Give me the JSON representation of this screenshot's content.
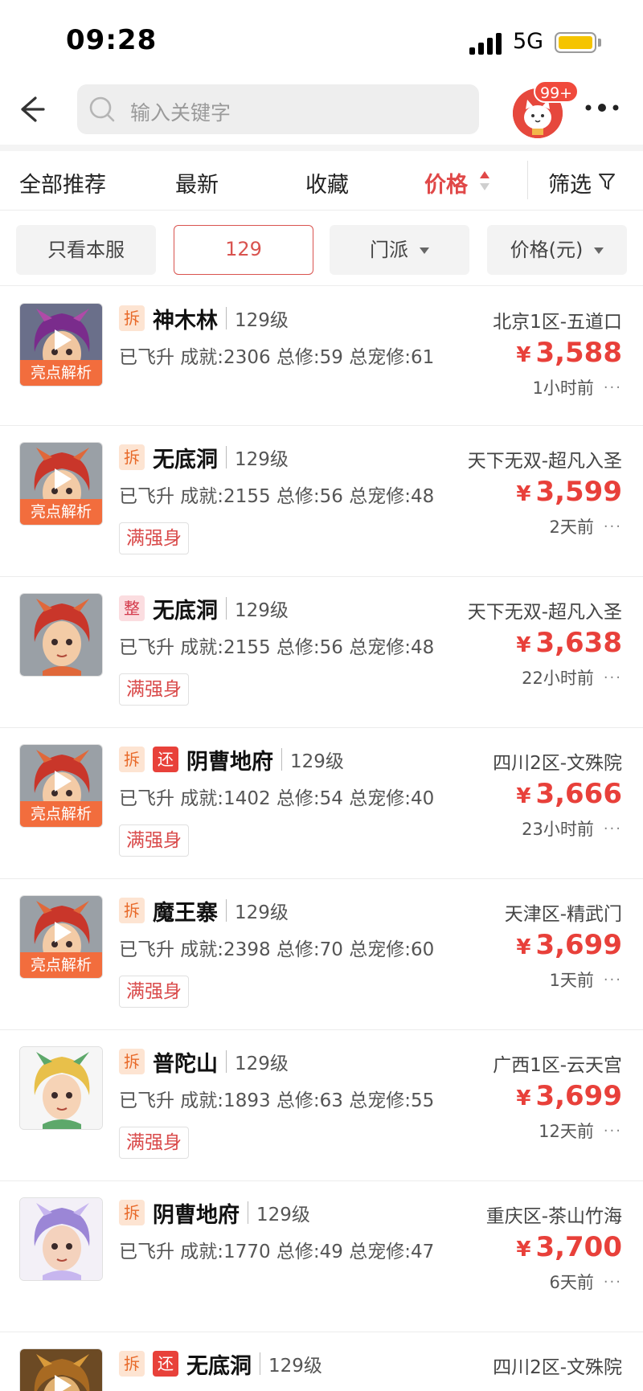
{
  "status_bar": {
    "time": "09:28",
    "network": "5G"
  },
  "search": {
    "placeholder": "输入关键字",
    "badge": "99+"
  },
  "sort_tabs": [
    {
      "label": "全部推荐",
      "active": false
    },
    {
      "label": "最新",
      "active": false
    },
    {
      "label": "收藏",
      "active": false
    },
    {
      "label": "价格",
      "active": true
    },
    {
      "label": "筛选",
      "active": false
    }
  ],
  "chips": [
    {
      "label": "只看本服"
    },
    {
      "label": "129"
    },
    {
      "label": "门派"
    },
    {
      "label": "价格(元)"
    }
  ],
  "labels": {
    "highlight": "亮点解析",
    "yen": "¥",
    "more": "···"
  },
  "colors": {
    "accent": "#e8403a",
    "tag_chai": "#e86a2a",
    "tag_huan": "#e8413a",
    "highlight": "#f26d3d"
  },
  "listings": [
    {
      "tags": [
        "拆"
      ],
      "school": "神木林",
      "level": "129级",
      "server": "北京1区-五道口",
      "stats": "已飞升 成就:2306 总修:59 总宠修:61",
      "price": "3,588",
      "time": "1小时前",
      "strong": "",
      "video": true,
      "avatar": "purple-hair"
    },
    {
      "tags": [
        "拆"
      ],
      "school": "无底洞",
      "level": "129级",
      "server": "天下无双-超凡入圣",
      "stats": "已飞升 成就:2155 总修:56 总宠修:48",
      "price": "3,599",
      "time": "2天前",
      "strong": "满强身",
      "video": true,
      "avatar": "red-hair"
    },
    {
      "tags": [
        "整"
      ],
      "school": "无底洞",
      "level": "129级",
      "server": "天下无双-超凡入圣",
      "stats": "已飞升 成就:2155 总修:56 总宠修:48",
      "price": "3,638",
      "time": "22小时前",
      "strong": "满强身",
      "video": false,
      "avatar": "red-hair"
    },
    {
      "tags": [
        "拆",
        "还"
      ],
      "school": "阴曹地府",
      "level": "129级",
      "server": "四川2区-文殊院",
      "stats": "已飞升 成就:1402 总修:54 总宠修:40",
      "price": "3,666",
      "time": "23小时前",
      "strong": "满强身",
      "video": true,
      "avatar": "red-hair"
    },
    {
      "tags": [
        "拆"
      ],
      "school": "魔王寨",
      "level": "129级",
      "server": "天津区-精武门",
      "stats": "已飞升 成就:2398 总修:70 总宠修:60",
      "price": "3,699",
      "time": "1天前",
      "strong": "满强身",
      "video": true,
      "avatar": "red-hair"
    },
    {
      "tags": [
        "拆"
      ],
      "school": "普陀山",
      "level": "129级",
      "server": "广西1区-云天宫",
      "stats": "已飞升 成就:1893 总修:63 总宠修:55",
      "price": "3,699",
      "time": "12天前",
      "strong": "满强身",
      "video": false,
      "avatar": "green-hair"
    },
    {
      "tags": [
        "拆"
      ],
      "school": "阴曹地府",
      "level": "129级",
      "server": "重庆区-茶山竹海",
      "stats": "已飞升 成就:1770 总修:49 总宠修:47",
      "price": "3,700",
      "time": "6天前",
      "strong": "",
      "video": false,
      "avatar": "lavender-hair"
    },
    {
      "tags": [
        "拆",
        "还"
      ],
      "school": "无底洞",
      "level": "129级",
      "server": "四川2区-文殊院",
      "stats": "",
      "price": "",
      "time": "",
      "strong": "",
      "video": true,
      "avatar": "tiger"
    }
  ]
}
